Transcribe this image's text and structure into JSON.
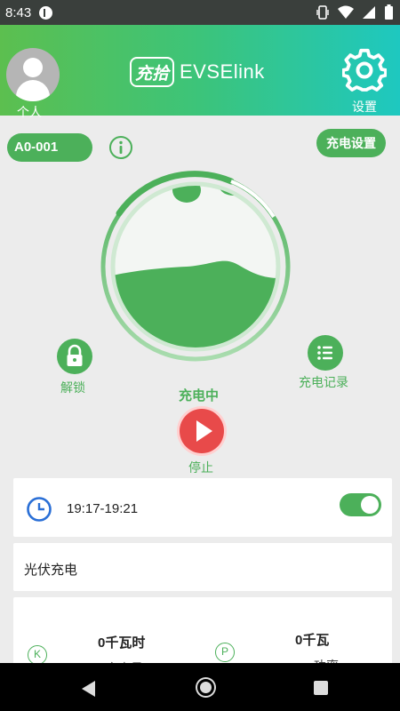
{
  "status_bar": {
    "time": "8:43"
  },
  "header": {
    "personal_label": "个人",
    "logo_mark": "充拾",
    "logo_text": "EVSElink",
    "settings_label": "设置"
  },
  "device": {
    "id": "A0-001",
    "charge_settings_label": "充电设置"
  },
  "actions": {
    "unlock_label": "解锁",
    "records_label": "充电记录",
    "status_text": "充电中",
    "stop_label": "停止"
  },
  "schedule": {
    "time_range": "19:17-19:21",
    "enabled": true
  },
  "solar": {
    "label": "光伏充电"
  },
  "stats": {
    "energy_icon": "K",
    "energy_value": "0千瓦时",
    "energy_label": "充电量",
    "power_icon": "P",
    "power_value": "0千瓦",
    "power_label": "功率"
  },
  "colors": {
    "accent": "#4cb05a",
    "header_start": "#5cbf4f",
    "header_end": "#1ec8c0",
    "stop": "#e84a4a",
    "clock": "#2a6fd6"
  },
  "icons": {
    "avatar": "person-avatar-icon",
    "settings": "gear-icon",
    "info": "info-icon",
    "unlock": "lock-icon",
    "records": "list-icon",
    "stop": "play-icon",
    "schedule": "clock-icon"
  }
}
